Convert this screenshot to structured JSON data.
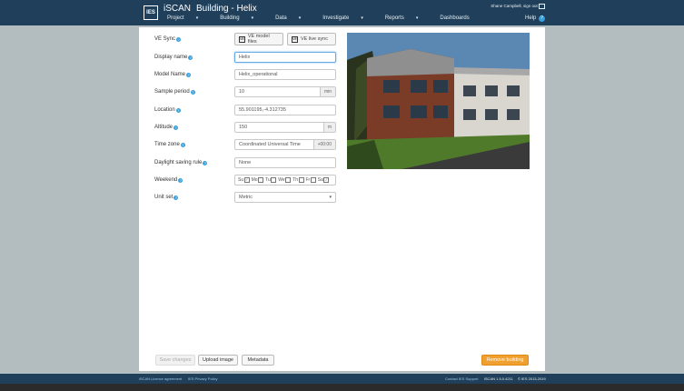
{
  "header": {
    "app_name": "iSCAN",
    "page_title": "Building - Helix",
    "logo_text": "IES",
    "user_text": "Shane Campbell, sign out",
    "help_label": "Help",
    "help_icon": "?",
    "nav": [
      {
        "label": "Project",
        "caret": "▾"
      },
      {
        "label": "Building",
        "caret": "▾"
      },
      {
        "label": "Data",
        "caret": "▾"
      },
      {
        "label": "Investigate",
        "caret": "▾"
      },
      {
        "label": "Reports",
        "caret": "▾"
      },
      {
        "label": "Dashboards",
        "caret": ""
      }
    ]
  },
  "form": {
    "ve_sync": {
      "label": "VE Sync",
      "files_btn": "VE model files",
      "live_btn": "VE live sync",
      "icon_text": "VE"
    },
    "display_name": {
      "label": "Display name",
      "value": "Helix"
    },
    "model_name": {
      "label": "Model Name",
      "value": "Helix_operational"
    },
    "sample_period": {
      "label": "Sample period",
      "value": "10",
      "unit": "min"
    },
    "location": {
      "label": "Location",
      "value": "55.901195,-4.312735"
    },
    "altitude": {
      "label": "Altitude",
      "value": "150",
      "unit": "m"
    },
    "time_zone": {
      "label": "Time zone",
      "value": "Coordinated Universal Time",
      "offset": "+00:00"
    },
    "daylight": {
      "label": "Daylight saving rule",
      "value": "None"
    },
    "weekend": {
      "label": "Weekend",
      "days": [
        "Su",
        "Mo",
        "Tu",
        "We",
        "Th",
        "Fr",
        "Sa"
      ],
      "checked": [
        true,
        false,
        false,
        false,
        false,
        false,
        true
      ]
    },
    "unit_set": {
      "label": "Unit set",
      "value": "Metric",
      "caret": "▾"
    },
    "help_mark": "?"
  },
  "actions": {
    "save": "Save changes",
    "upload": "Upload image",
    "metadata": "Metadata",
    "remove": "Remove building"
  },
  "footer": {
    "licence": "iSCAN Licence agreement",
    "privacy": "IES Privacy Policy",
    "support": "Contact IES Support",
    "version": "iSCAN 1.5.0.4211",
    "copyright": "© IES 2013-2019"
  }
}
